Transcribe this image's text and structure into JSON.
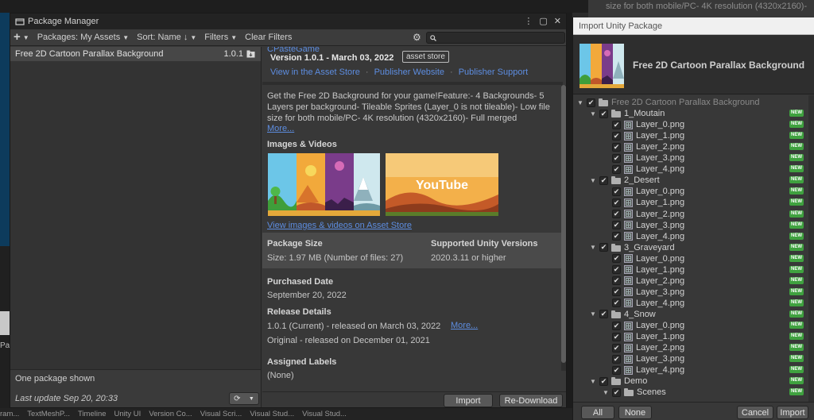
{
  "background": {
    "left_text": "Pat",
    "right_top_text": "size for both mobile/PC- 4K resolution (4320x2160)-",
    "bottom_tabs": [
      "ram...",
      "TextMeshP...",
      "Timeline",
      "Unity UI",
      "Version Co...",
      "Visual Scri...",
      "Visual Stud...",
      "Visual Stud..."
    ]
  },
  "package_manager": {
    "title": "Package Manager",
    "toolbar": {
      "add": "+",
      "packages_filter": "Packages: My Assets",
      "sort": "Sort: Name ↓",
      "filters": "Filters",
      "clear_filters": "Clear Filters",
      "search_value": ""
    },
    "list": {
      "items": [
        {
          "name": "Free 2D Cartoon Parallax Background",
          "version": "1.0.1"
        }
      ],
      "count_text": "One package shown",
      "last_update": "Last update Sep 20, 20:33"
    },
    "detail": {
      "publisher": "CPasteGame",
      "version": "Version 1.0.1 - March 03, 2022",
      "badge": "asset store",
      "link_asset_store": "View in the Asset Store",
      "link_publisher_site": "Publisher Website",
      "link_publisher_support": "Publisher Support",
      "link_sep": "·",
      "description": "Get the Free 2D Background for your game!Feature:- 4 Backgrounds- 5 Layers per background- Tileable Sprites (Layer_0 is not tileable)- Low file size for both mobile/PC- 4K resolution (4320x2160)- Full merged",
      "more": "More...",
      "images_heading": "Images & Videos",
      "youtube_text": "YouTube",
      "view_images": "View images & videos on Asset Store",
      "package_size_label": "Package Size",
      "package_size_value": "Size: 1.97 MB (Number of files: 27)",
      "supported_label": "Supported Unity Versions",
      "supported_value": "2020.3.11 or higher",
      "purchased_label": "Purchased Date",
      "purchased_value": "September 20, 2022",
      "release_label": "Release Details",
      "release_current": "1.0.1 (Current) - released on March 03, 2022",
      "release_more": "More...",
      "release_original": "Original - released on December 01, 2021",
      "labels_label": "Assigned Labels",
      "labels_value": "(None)",
      "import_btn": "Import",
      "redownload_btn": "Re-Download"
    }
  },
  "import_window": {
    "title": "Import Unity Package",
    "package_name": "Free 2D Cartoon Parallax Background",
    "new_badge": "NEW",
    "tree": [
      {
        "depth": 0,
        "type": "folder",
        "label": "Free 2D Cartoon Parallax Background",
        "expanded": true,
        "dim": true
      },
      {
        "depth": 1,
        "type": "folder",
        "label": "1_Moutain",
        "expanded": true
      },
      {
        "depth": 2,
        "type": "file",
        "label": "Layer_0.png"
      },
      {
        "depth": 2,
        "type": "file",
        "label": "Layer_1.png"
      },
      {
        "depth": 2,
        "type": "file",
        "label": "Layer_2.png"
      },
      {
        "depth": 2,
        "type": "file",
        "label": "Layer_3.png"
      },
      {
        "depth": 2,
        "type": "file",
        "label": "Layer_4.png"
      },
      {
        "depth": 1,
        "type": "folder",
        "label": "2_Desert",
        "expanded": true
      },
      {
        "depth": 2,
        "type": "file",
        "label": "Layer_0.png"
      },
      {
        "depth": 2,
        "type": "file",
        "label": "Layer_1.png"
      },
      {
        "depth": 2,
        "type": "file",
        "label": "Layer_2.png"
      },
      {
        "depth": 2,
        "type": "file",
        "label": "Layer_3.png"
      },
      {
        "depth": 2,
        "type": "file",
        "label": "Layer_4.png"
      },
      {
        "depth": 1,
        "type": "folder",
        "label": "3_Graveyard",
        "expanded": true
      },
      {
        "depth": 2,
        "type": "file",
        "label": "Layer_0.png"
      },
      {
        "depth": 2,
        "type": "file",
        "label": "Layer_1.png"
      },
      {
        "depth": 2,
        "type": "file",
        "label": "Layer_2.png"
      },
      {
        "depth": 2,
        "type": "file",
        "label": "Layer_3.png"
      },
      {
        "depth": 2,
        "type": "file",
        "label": "Layer_4.png"
      },
      {
        "depth": 1,
        "type": "folder",
        "label": "4_Snow",
        "expanded": true
      },
      {
        "depth": 2,
        "type": "file",
        "label": "Layer_0.png"
      },
      {
        "depth": 2,
        "type": "file",
        "label": "Layer_1.png"
      },
      {
        "depth": 2,
        "type": "file",
        "label": "Layer_2.png"
      },
      {
        "depth": 2,
        "type": "file",
        "label": "Layer_3.png"
      },
      {
        "depth": 2,
        "type": "file",
        "label": "Layer_4.png"
      },
      {
        "depth": 1,
        "type": "folder",
        "label": "Demo",
        "expanded": true
      },
      {
        "depth": 2,
        "type": "folder",
        "label": "Scenes",
        "expanded": true
      }
    ],
    "all_btn": "All",
    "none_btn": "None",
    "cancel_btn": "Cancel",
    "import_btn": "Import"
  }
}
